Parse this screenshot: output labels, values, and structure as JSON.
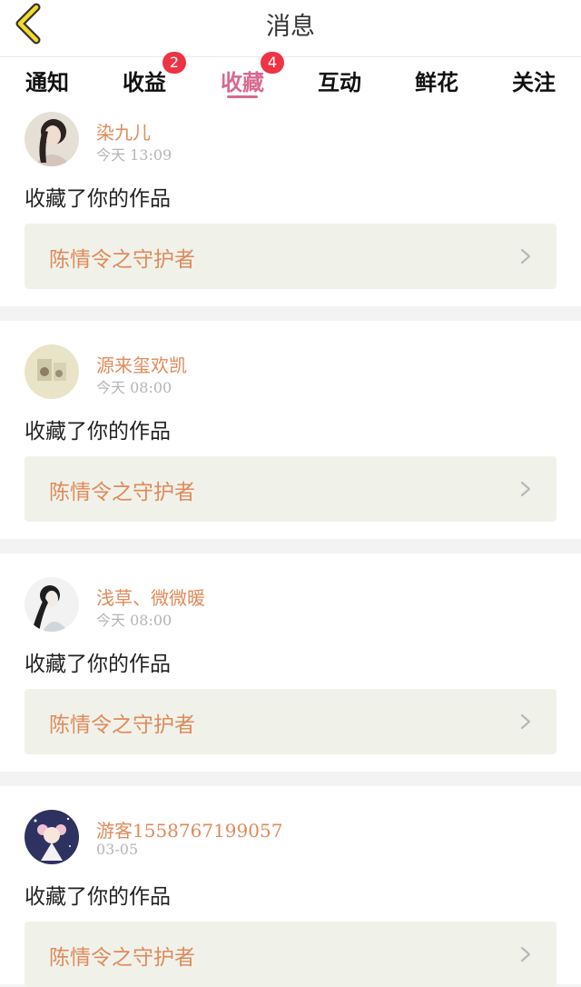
{
  "header": {
    "title": "消息",
    "back_icon": "chevron-left-icon"
  },
  "tabs": [
    {
      "label": "通知"
    },
    {
      "label": "收益",
      "badge": "2"
    },
    {
      "label": "收藏",
      "badge": "4",
      "active": true
    },
    {
      "label": "互动"
    },
    {
      "label": "鲜花"
    },
    {
      "label": "关注"
    }
  ],
  "colors": {
    "accent": "#d9688f",
    "username": "#e08a5a",
    "badge": "#ee3344",
    "work_bg": "#f0f2ea"
  },
  "messages": [
    {
      "user": "染九儿",
      "time": "今天  13:09",
      "action": "收藏了你的作品",
      "work": "陈情令之守护者"
    },
    {
      "user": "源来玺欢凯",
      "time": "今天  08:00",
      "action": "收藏了你的作品",
      "work": "陈情令之守护者"
    },
    {
      "user": "浅草、微微暖",
      "time": "今天  08:00",
      "action": "收藏了你的作品",
      "work": "陈情令之守护者"
    },
    {
      "user": "游客1558767199057",
      "time": "03-05",
      "action": "收藏了你的作品",
      "work": "陈情令之守护者"
    }
  ]
}
